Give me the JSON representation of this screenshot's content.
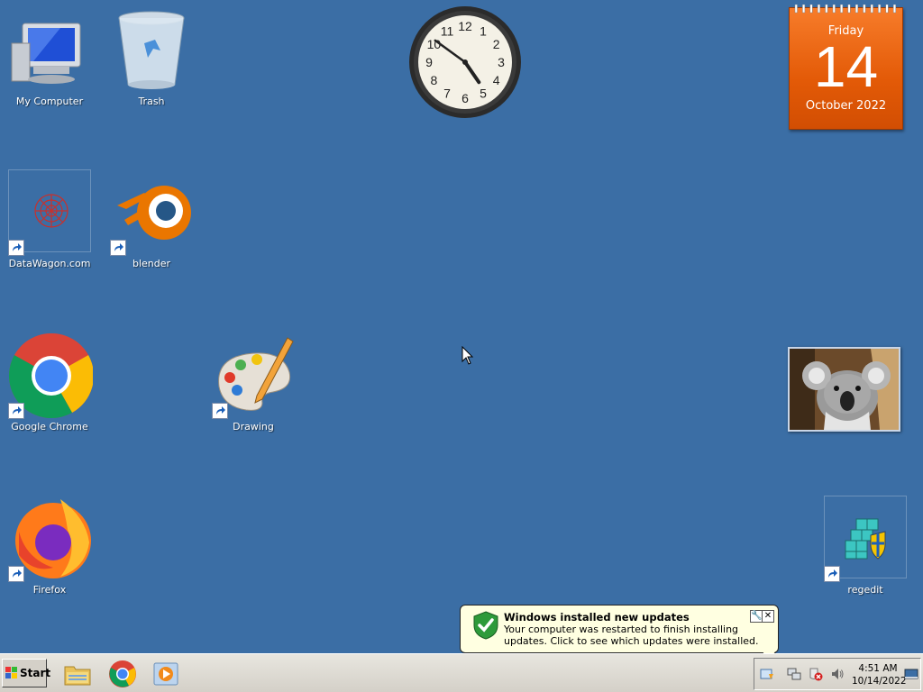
{
  "desktop": {
    "icons": [
      {
        "label": "My Computer",
        "icon": "computer-icon"
      },
      {
        "label": "Trash",
        "icon": "recycle-bin-icon"
      },
      {
        "label": "DataWagon.com",
        "icon": "datawagon-icon",
        "shortcut": true
      },
      {
        "label": "blender",
        "icon": "blender-icon",
        "shortcut": true
      },
      {
        "label": "Google Chrome",
        "icon": "chrome-icon",
        "shortcut": true
      },
      {
        "label": "Drawing",
        "icon": "paint-palette-icon",
        "shortcut": true
      },
      {
        "label": "Firefox",
        "icon": "firefox-icon",
        "shortcut": true
      },
      {
        "label": "regedit",
        "icon": "regedit-icon",
        "shortcut": true
      }
    ],
    "background_color": "#3b6ea5"
  },
  "gadgets": {
    "clock": {
      "hour": 4,
      "minute": 51,
      "numerals": [
        "12",
        "1",
        "2",
        "3",
        "4",
        "5",
        "6",
        "7",
        "8",
        "9",
        "10",
        "11"
      ]
    },
    "calendar": {
      "weekday": "Friday",
      "day": "14",
      "month_year": "October 2022",
      "color": "#e35a07"
    },
    "photo": {
      "subject": "koala"
    }
  },
  "notification": {
    "title": "Windows installed new updates",
    "message": "Your computer was restarted to finish installing updates. Click to see which updates were installed.",
    "icon": "shield-check-icon"
  },
  "taskbar": {
    "start_label": "Start",
    "quick_launch": [
      "file-explorer-icon",
      "chrome-icon",
      "media-player-icon"
    ],
    "tray_icons": [
      "windows-update-icon",
      "network-icon",
      "security-alert-icon",
      "volume-icon",
      "show-desktop-icon"
    ],
    "time": "4:51 AM",
    "date": "10/14/2022"
  }
}
